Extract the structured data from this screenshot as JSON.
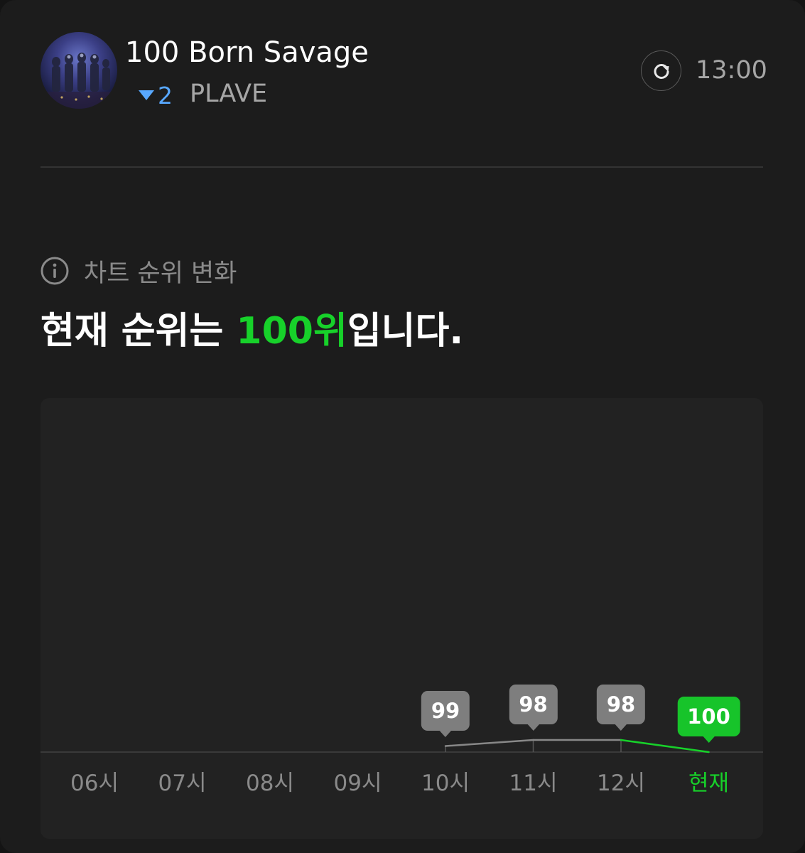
{
  "song": {
    "rank": "100",
    "title": "Born Savage",
    "rank_change": "2",
    "rank_change_direction": "down",
    "artist": "PLAVE",
    "avatar_icon": "album-art-avatar"
  },
  "header": {
    "refresh_icon": "refresh-icon",
    "time": "13:00"
  },
  "section": {
    "info_icon": "info-icon",
    "label": "차트 순위 변화"
  },
  "headline": {
    "prefix": "현재 순위는 ",
    "highlight": "100위",
    "suffix": "입니다."
  },
  "colors": {
    "accent_green": "#17d12a",
    "rank_down_blue": "#58a8ff",
    "muted_text": "#8a8a8a",
    "tooltip_gray": "#7e7e7e"
  },
  "chart_data": {
    "type": "line",
    "categories": [
      "06시",
      "07시",
      "08시",
      "09시",
      "10시",
      "11시",
      "12시",
      "현재"
    ],
    "values": [
      null,
      null,
      null,
      null,
      99,
      98,
      98,
      100
    ],
    "data_labels": [
      "",
      "",
      "",
      "",
      "99",
      "98",
      "98",
      "100"
    ],
    "highlight_category": "현재",
    "y_inverted": true,
    "grid": false
  }
}
